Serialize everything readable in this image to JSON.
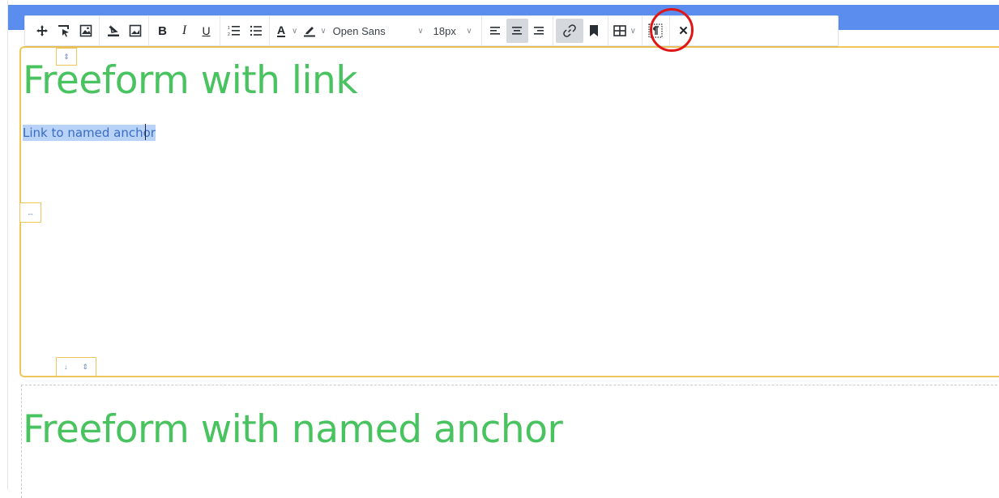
{
  "toolbar": {
    "font_family": "Open Sans",
    "font_size": "18px",
    "active_button": "link",
    "icons": [
      "move-icon",
      "select-icon",
      "image-icon",
      "fill-icon",
      "background-image-icon",
      "bold-icon",
      "italic-icon",
      "underline-icon",
      "ordered-list-icon",
      "unordered-list-icon",
      "text-color-icon",
      "highlight-icon",
      "align-left-icon",
      "align-center-icon",
      "align-right-icon",
      "link-icon",
      "bookmark-icon",
      "table-icon",
      "paragraph-marks-icon",
      "close-icon"
    ],
    "labels": {
      "bold": "B",
      "italic": "I",
      "underline": "U",
      "text_color": "A",
      "close": "✕"
    }
  },
  "blocks": [
    {
      "heading": "Freeform with link",
      "link_text": "Link to named anchor",
      "selected": true
    },
    {
      "heading": "Freeform with named anchor"
    }
  ],
  "colors": {
    "heading": "#48c35f",
    "selection": "#b8d3f7",
    "link": "#3a6dc2",
    "active_border": "#f0c65a",
    "topbar": "#5b8def",
    "annotation": "#e01616"
  }
}
